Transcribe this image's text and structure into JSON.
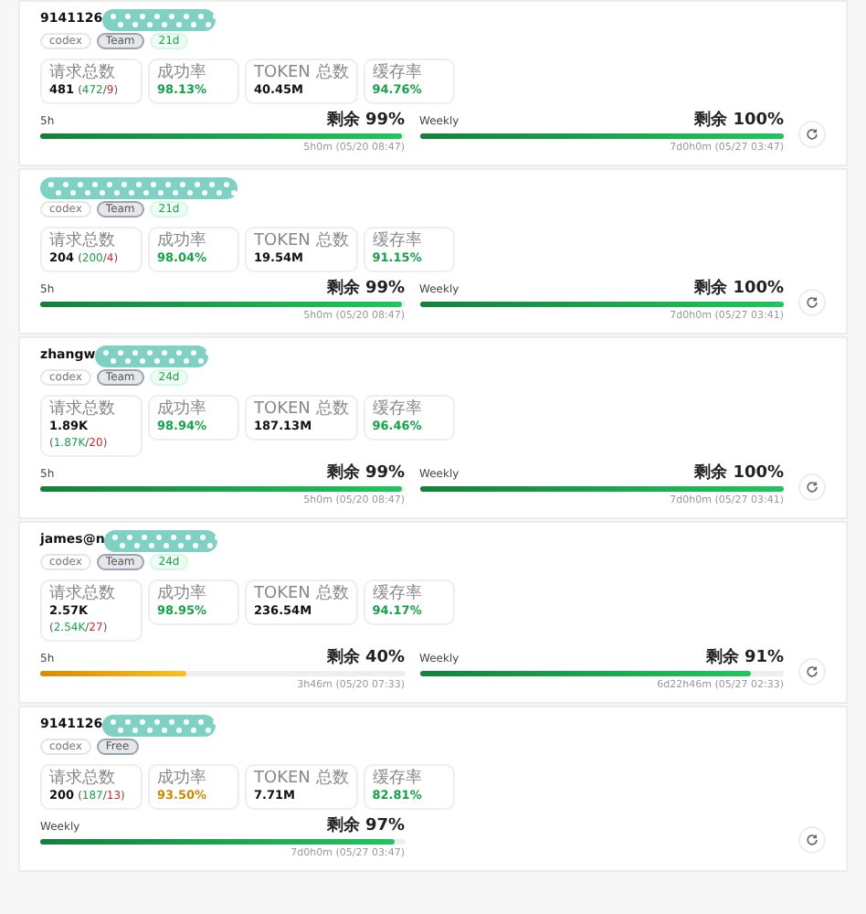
{
  "accounts": [
    {
      "name": "9141126",
      "redacted": true,
      "tags": [
        {
          "kind": "platform",
          "label": "codex"
        },
        {
          "kind": "plan",
          "label": "Team"
        },
        {
          "kind": "age",
          "label": "21d"
        }
      ],
      "stats": [
        {
          "kind": "requests",
          "label": "请求总数",
          "value": "481",
          "open": "(",
          "ok": "472",
          "sep": "/",
          "fail": "9",
          "close": ")"
        },
        {
          "kind": "plain",
          "label": "成功率",
          "value": "98.13%",
          "color": "#16a34a"
        },
        {
          "kind": "plain",
          "label": "TOKEN 总数",
          "value": "40.45M"
        },
        {
          "kind": "plain",
          "label": "缓存率",
          "value": "94.76%",
          "color": "#16a34a"
        }
      ],
      "quotas": [
        {
          "label": "5h",
          "remaining": "剩余 99%",
          "level": 0.99,
          "reset": "5h0m (05/20 08:47)"
        },
        {
          "label": "Weekly",
          "remaining": "剩余 100%",
          "level": 1,
          "reset": "7d0h0m (05/27 03:47)"
        }
      ]
    },
    {
      "redacted": true,
      "tags": [
        {
          "kind": "platform",
          "label": "codex"
        },
        {
          "kind": "plan",
          "label": "Team"
        },
        {
          "kind": "age",
          "label": "21d"
        }
      ],
      "stats": [
        {
          "kind": "requests",
          "label": "请求总数",
          "value": "204",
          "open": "(",
          "ok": "200",
          "sep": "/",
          "fail": "4",
          "close": ")"
        },
        {
          "kind": "plain",
          "label": "成功率",
          "value": "98.04%",
          "color": "#16a34a"
        },
        {
          "kind": "plain",
          "label": "TOKEN 总数",
          "value": "19.54M"
        },
        {
          "kind": "plain",
          "label": "缓存率",
          "value": "91.15%",
          "color": "#16a34a"
        }
      ],
      "quotas": [
        {
          "label": "5h",
          "remaining": "剩余 99%",
          "level": 0.99,
          "reset": "5h0m (05/20 08:47)"
        },
        {
          "label": "Weekly",
          "remaining": "剩余 100%",
          "level": 1,
          "reset": "7d0h0m (05/27 03:41)"
        }
      ]
    },
    {
      "name": "zhangw",
      "redacted": true,
      "tags": [
        {
          "kind": "platform",
          "label": "codex"
        },
        {
          "kind": "plan",
          "label": "Team"
        },
        {
          "kind": "age",
          "label": "24d"
        }
      ],
      "stats": [
        {
          "kind": "requests",
          "label": "请求总数",
          "value": "1.89K",
          "open": "(",
          "ok": "1.87K",
          "sep": "/",
          "fail": "20",
          "close": ")"
        },
        {
          "kind": "plain",
          "label": "成功率",
          "value": "98.94%",
          "color": "#16a34a"
        },
        {
          "kind": "plain",
          "label": "TOKEN 总数",
          "value": "187.13M"
        },
        {
          "kind": "plain",
          "label": "缓存率",
          "value": "96.46%",
          "color": "#16a34a"
        }
      ],
      "quotas": [
        {
          "label": "5h",
          "remaining": "剩余 99%",
          "level": 0.99,
          "reset": "5h0m (05/20 08:47)"
        },
        {
          "label": "Weekly",
          "remaining": "剩余 100%",
          "level": 1,
          "reset": "7d0h0m (05/27 03:41)"
        }
      ]
    },
    {
      "name": "james@n",
      "redacted": true,
      "tags": [
        {
          "kind": "platform",
          "label": "codex"
        },
        {
          "kind": "plan",
          "label": "Team"
        },
        {
          "kind": "age",
          "label": "24d"
        }
      ],
      "stats": [
        {
          "kind": "requests",
          "label": "请求总数",
          "value": "2.57K",
          "open": "(",
          "ok": "2.54K",
          "sep": "/",
          "fail": "27",
          "close": ")"
        },
        {
          "kind": "plain",
          "label": "成功率",
          "value": "98.95%",
          "color": "#16a34a"
        },
        {
          "kind": "plain",
          "label": "TOKEN 总数",
          "value": "236.54M"
        },
        {
          "kind": "plain",
          "label": "缓存率",
          "value": "94.17%",
          "color": "#16a34a"
        }
      ],
      "quotas": [
        {
          "label": "5h",
          "remaining": "剩余 40%",
          "level": 0.4,
          "reset": "3h46m (05/20 07:33)"
        },
        {
          "label": "Weekly",
          "remaining": "剩余 91%",
          "level": 0.91,
          "reset": "6d22h46m (05/27 02:33)"
        }
      ]
    },
    {
      "name": "9141126",
      "redacted": true,
      "tags": [
        {
          "kind": "platform",
          "label": "codex"
        },
        {
          "kind": "plan",
          "label": "Free"
        }
      ],
      "stats": [
        {
          "kind": "requests",
          "label": "请求总数",
          "value": "200",
          "open": "(",
          "ok": "187",
          "sep": "/",
          "fail": "13",
          "close": ")"
        },
        {
          "kind": "plain",
          "label": "成功率",
          "value": "93.50%",
          "color": "#ca8a04"
        },
        {
          "kind": "plain",
          "label": "TOKEN 总数",
          "value": "7.71M"
        },
        {
          "kind": "plain",
          "label": "缓存率",
          "value": "82.81%",
          "color": "#16a34a"
        }
      ],
      "quotas": [
        {
          "label": "Weekly",
          "remaining": "剩余 97%",
          "level": 0.97,
          "reset": "7d0h0m (05/27 03:47)"
        }
      ]
    }
  ]
}
